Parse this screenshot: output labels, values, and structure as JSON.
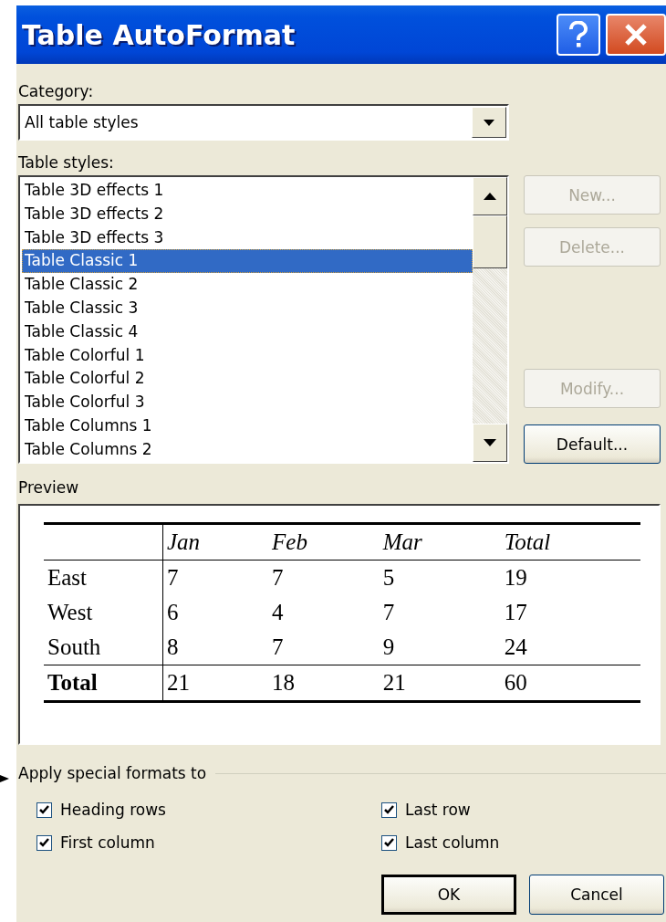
{
  "window": {
    "title": "Table AutoFormat"
  },
  "category": {
    "label": "Category:",
    "value": "All table styles"
  },
  "table_styles": {
    "label": "Table styles:",
    "items": [
      {
        "label": "Table 3D effects 1",
        "selected": false
      },
      {
        "label": "Table 3D effects 2",
        "selected": false
      },
      {
        "label": "Table 3D effects 3",
        "selected": false
      },
      {
        "label": "Table Classic 1",
        "selected": true
      },
      {
        "label": "Table Classic 2",
        "selected": false
      },
      {
        "label": "Table Classic 3",
        "selected": false
      },
      {
        "label": "Table Classic 4",
        "selected": false
      },
      {
        "label": "Table Colorful 1",
        "selected": false
      },
      {
        "label": "Table Colorful 2",
        "selected": false
      },
      {
        "label": "Table Colorful 3",
        "selected": false
      },
      {
        "label": "Table Columns 1",
        "selected": false
      },
      {
        "label": "Table Columns 2",
        "selected": false
      }
    ]
  },
  "side_buttons": [
    {
      "label": "New...",
      "disabled": true
    },
    {
      "label": "Delete...",
      "disabled": true
    },
    {
      "label": "Modify...",
      "disabled": true
    },
    {
      "label": "Default...",
      "disabled": false
    }
  ],
  "preview": {
    "label": "Preview",
    "columns": [
      "Jan",
      "Feb",
      "Mar",
      "Total"
    ],
    "rows": [
      {
        "kind": "data",
        "label": "East",
        "cells": [
          "7",
          "7",
          "5",
          "19"
        ]
      },
      {
        "kind": "data",
        "label": "West",
        "cells": [
          "6",
          "4",
          "7",
          "17"
        ]
      },
      {
        "kind": "data",
        "label": "South",
        "cells": [
          "8",
          "7",
          "9",
          "24"
        ]
      },
      {
        "kind": "total",
        "label": "Total",
        "cells": [
          "21",
          "18",
          "21",
          "60"
        ]
      }
    ]
  },
  "special_formats": {
    "label": "Apply special formats to",
    "options": [
      {
        "label": "Heading rows",
        "checked": true
      },
      {
        "label": "Last row",
        "checked": true
      },
      {
        "label": "First column",
        "checked": true
      },
      {
        "label": "Last column",
        "checked": true
      }
    ]
  },
  "buttons": [
    {
      "label": "OK",
      "default": true
    },
    {
      "label": "Cancel",
      "default": false
    }
  ]
}
